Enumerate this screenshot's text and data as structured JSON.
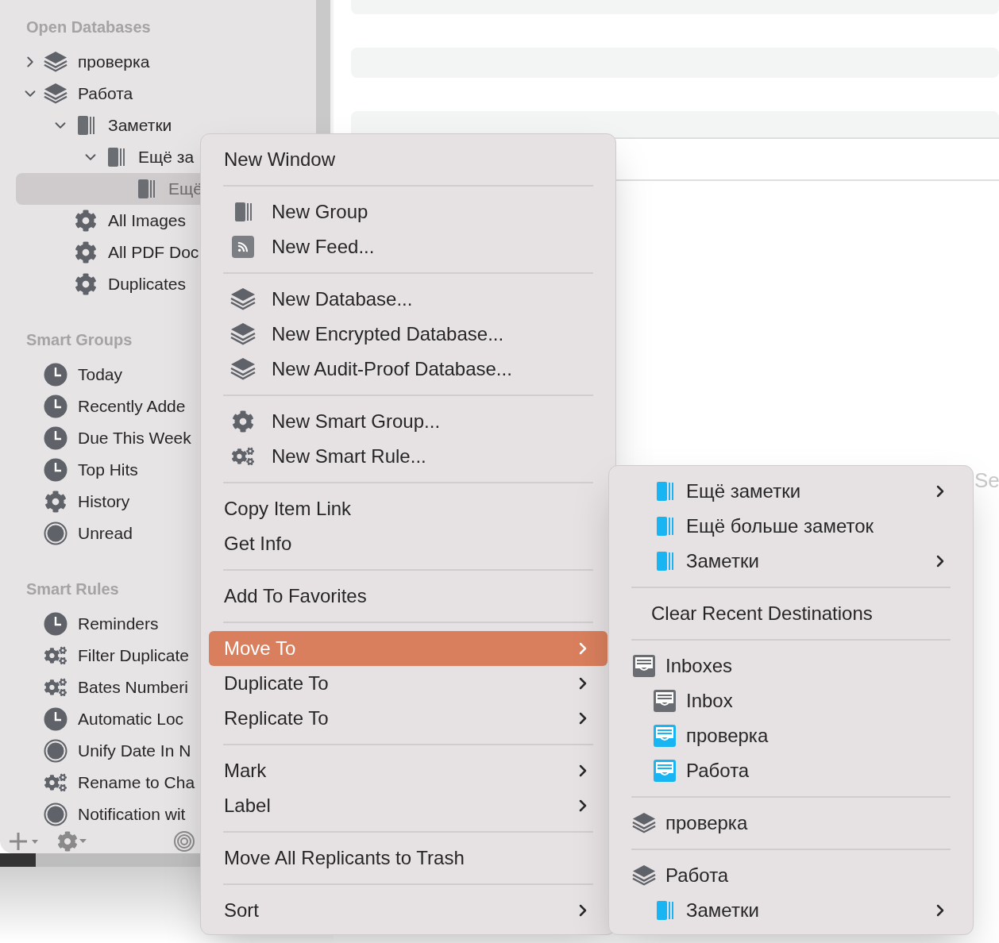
{
  "sidebar": {
    "sections": [
      {
        "heading": "Open Databases",
        "items": [
          {
            "label": "проверка",
            "kind": "database",
            "expanded": false,
            "selected": false
          },
          {
            "label": "Работа",
            "kind": "database",
            "expanded": true,
            "selected": false,
            "children": [
              {
                "label": "Заметки",
                "kind": "group",
                "expanded": true,
                "selected": false,
                "children": [
                  {
                    "label": "Ещё за",
                    "kind": "group",
                    "expanded": true,
                    "selected": false,
                    "children": [
                      {
                        "label": "Ещё",
                        "kind": "group",
                        "selected": true
                      }
                    ]
                  }
                ]
              },
              {
                "label": "All Images",
                "kind": "smart_group",
                "selected": false
              },
              {
                "label": "All PDF Doc",
                "kind": "smart_group",
                "selected": false
              },
              {
                "label": "Duplicates",
                "kind": "smart_group",
                "selected": false
              }
            ]
          }
        ]
      },
      {
        "heading": "Smart Groups",
        "items": [
          {
            "label": "Today",
            "kind": "clock",
            "selected": false
          },
          {
            "label": "Recently Adde",
            "kind": "clock",
            "selected": false
          },
          {
            "label": "Due This Week",
            "kind": "clock",
            "selected": false
          },
          {
            "label": "Top Hits",
            "kind": "clock",
            "selected": false
          },
          {
            "label": "History",
            "kind": "smart_group",
            "selected": false
          },
          {
            "label": "Unread",
            "kind": "ring",
            "selected": false
          }
        ]
      },
      {
        "heading": "Smart Rules",
        "items": [
          {
            "label": "Reminders",
            "kind": "clock",
            "selected": false
          },
          {
            "label": "Filter Duplicate",
            "kind": "smart_rule",
            "selected": false
          },
          {
            "label": "Bates Numberi",
            "kind": "smart_rule",
            "selected": false
          },
          {
            "label": "Automatic Loc",
            "kind": "clock",
            "selected": false
          },
          {
            "label": "Unify Date In N",
            "kind": "ring",
            "selected": false
          },
          {
            "label": "Rename to Cha",
            "kind": "smart_rule",
            "selected": false
          },
          {
            "label": "Notification wit",
            "kind": "ring",
            "selected": false
          }
        ]
      }
    ]
  },
  "main_view": {
    "text": "Se"
  },
  "context_menu": {
    "sections": [
      [
        {
          "label": "New Window",
          "kind": "text",
          "selected": false,
          "submenu": false
        }
      ],
      [
        {
          "label": "New Group",
          "kind": "group",
          "selected": false,
          "submenu": false
        },
        {
          "label": "New Feed...",
          "kind": "feed",
          "selected": false,
          "submenu": false
        }
      ],
      [
        {
          "label": "New Database...",
          "kind": "database",
          "selected": false,
          "submenu": false
        },
        {
          "label": "New Encrypted Database...",
          "kind": "database",
          "selected": false,
          "submenu": false
        },
        {
          "label": "New Audit-Proof Database...",
          "kind": "database",
          "selected": false,
          "submenu": false
        }
      ],
      [
        {
          "label": "New Smart Group...",
          "kind": "smart_group",
          "selected": false,
          "submenu": false
        },
        {
          "label": "New Smart Rule...",
          "kind": "smart_rule",
          "selected": false,
          "submenu": false
        }
      ],
      [
        {
          "label": "Copy Item Link",
          "kind": "text",
          "selected": false,
          "submenu": false
        },
        {
          "label": "Get Info",
          "kind": "text",
          "selected": false,
          "submenu": false
        }
      ],
      [
        {
          "label": "Add To Favorites",
          "kind": "text",
          "selected": false,
          "submenu": false
        }
      ],
      [
        {
          "label": "Move To",
          "kind": "text",
          "selected": true,
          "submenu": true
        },
        {
          "label": "Duplicate To",
          "kind": "text",
          "selected": false,
          "submenu": true
        },
        {
          "label": "Replicate To",
          "kind": "text",
          "selected": false,
          "submenu": true
        }
      ],
      [
        {
          "label": "Mark",
          "kind": "text",
          "selected": false,
          "submenu": true
        },
        {
          "label": "Label",
          "kind": "text",
          "selected": false,
          "submenu": true
        }
      ],
      [
        {
          "label": "Move All Replicants to Trash",
          "kind": "text",
          "selected": false,
          "submenu": false
        }
      ],
      [
        {
          "label": "Sort",
          "kind": "text",
          "selected": false,
          "submenu": true
        }
      ]
    ]
  },
  "move_to_submenu": {
    "sections": [
      [
        {
          "kind": "group",
          "label": "Ещё заметки",
          "submenu": true
        },
        {
          "kind": "group",
          "label": "Ещё больше заметок",
          "submenu": false
        },
        {
          "kind": "group",
          "label": "Заметки",
          "submenu": true
        }
      ],
      [
        {
          "kind": "text",
          "label": "Clear Recent Destinations",
          "submenu": false
        }
      ],
      [
        {
          "kind": "inbox",
          "label": "Inboxes",
          "submenu": false,
          "children": [
            {
              "label": "Inbox",
              "kind": "inbox",
              "submenu": false
            },
            {
              "label": "проверка",
              "kind": "database_inbox",
              "submenu": false
            },
            {
              "label": "Работа",
              "kind": "database_inbox",
              "submenu": false
            }
          ]
        }
      ],
      [
        {
          "kind": "database",
          "label": "проверка",
          "submenu": false
        }
      ],
      [
        {
          "kind": "database",
          "label": "Работа",
          "submenu": false,
          "children": [
            {
              "label": "Заметки",
              "kind": "group",
              "submenu": true
            }
          ]
        }
      ]
    ]
  }
}
